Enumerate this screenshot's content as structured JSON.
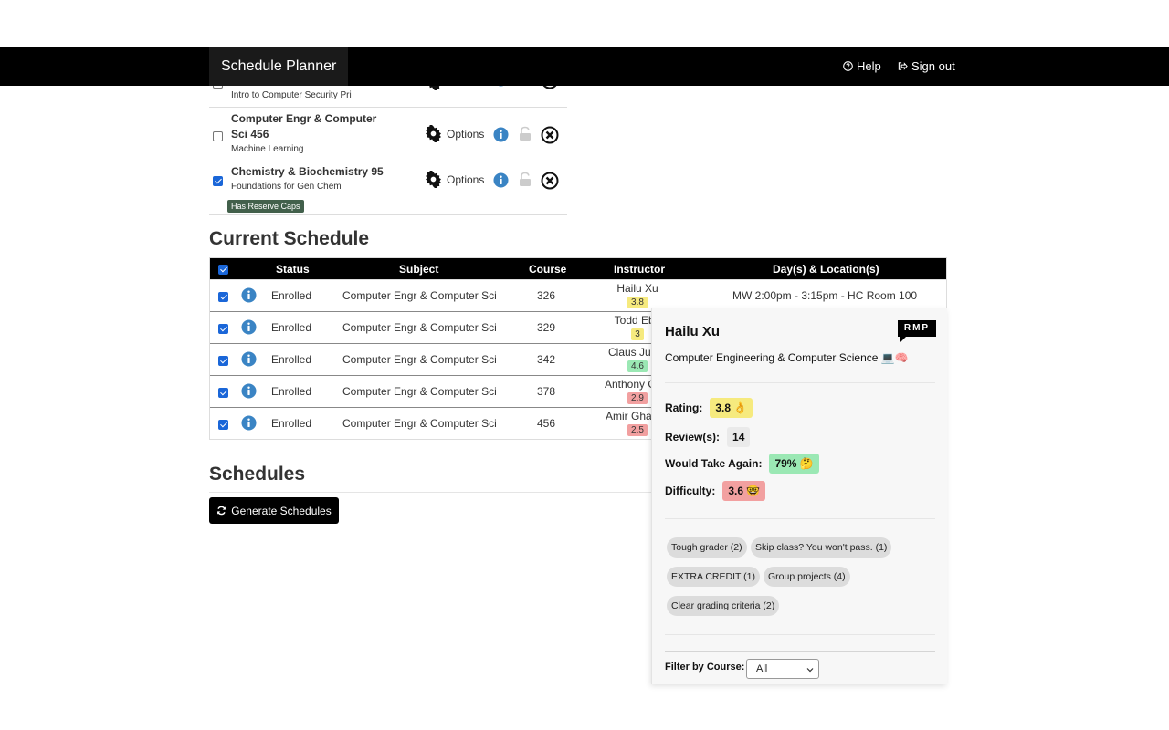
{
  "navbar": {
    "brand": "Schedule Planner",
    "help": "Help",
    "sign_out": "Sign out"
  },
  "course_list": [
    {
      "title": "",
      "subtitle": "Intro to Computer Security Pri",
      "checked": false,
      "options": "Options"
    },
    {
      "title": "Computer Engr & Computer Sci 456",
      "subtitle": "Machine Learning",
      "checked": false,
      "options": "Options"
    },
    {
      "title": "Chemistry & Biochemistry 95",
      "subtitle": "Foundations for Gen Chem",
      "checked": true,
      "options": "Options",
      "badge": "Has Reserve Caps"
    }
  ],
  "current_schedule": {
    "heading": "Current Schedule",
    "columns": [
      "Status",
      "Subject",
      "Course",
      "Instructor",
      "Day(s) & Location(s)"
    ],
    "rows": [
      {
        "status": "Enrolled",
        "subject": "Computer Engr & Computer Sci",
        "course": "326",
        "instructor": "Hailu Xu",
        "rating": "3.8",
        "rating_color": "#f6ea7e",
        "location": "MW 2:00pm - 3:15pm - HC Room 100"
      },
      {
        "status": "Enrolled",
        "subject": "Computer Engr & Computer Sci",
        "course": "329",
        "instructor": "Todd Ebe",
        "rating": "3",
        "rating_color": "#f6ea7e",
        "location": ""
      },
      {
        "status": "Enrolled",
        "subject": "Computer Engr & Computer Sci",
        "course": "342",
        "instructor": "Claus Jurge",
        "rating": "4.6",
        "rating_color": "#9be8b4",
        "location": ""
      },
      {
        "status": "Enrolled",
        "subject": "Computer Engr & Computer Sci",
        "course": "378",
        "instructor": "Anthony Giac",
        "rating": "2.9",
        "rating_color": "#f2a0a0",
        "location": ""
      },
      {
        "status": "Enrolled",
        "subject": "Computer Engr & Computer Sci",
        "course": "456",
        "instructor": "Amir Ghasen",
        "rating": "2.5",
        "rating_color": "#f2a0a0",
        "location": ""
      }
    ]
  },
  "schedules": {
    "heading": "Schedules",
    "generate_label": "Generate Schedules"
  },
  "rmp_popup": {
    "logo": "RMP",
    "name": "Hailu Xu",
    "department": "Computer Engineering & Computer Science 💻🧠",
    "rating_label": "Rating:",
    "rating_value": "3.8 👌",
    "reviews_label": "Review(s):",
    "reviews_value": "14",
    "take_again_label": "Would Take Again:",
    "take_again_value": "79% 🤔",
    "difficulty_label": "Difficulty:",
    "difficulty_value": "3.6 🤓",
    "tags": [
      "Tough grader (2)",
      "Skip class? You won't pass. (1)",
      "EXTRA CREDIT (1)",
      "Group projects (4)",
      "Clear grading criteria (2)"
    ],
    "filter_label": "Filter by Course:",
    "filter_value": "All"
  },
  "colors": {
    "navbar": "#000000",
    "accent_checkbox": "#1a66d8",
    "info_icon": "#3a84c4",
    "badge": "#42604b"
  }
}
